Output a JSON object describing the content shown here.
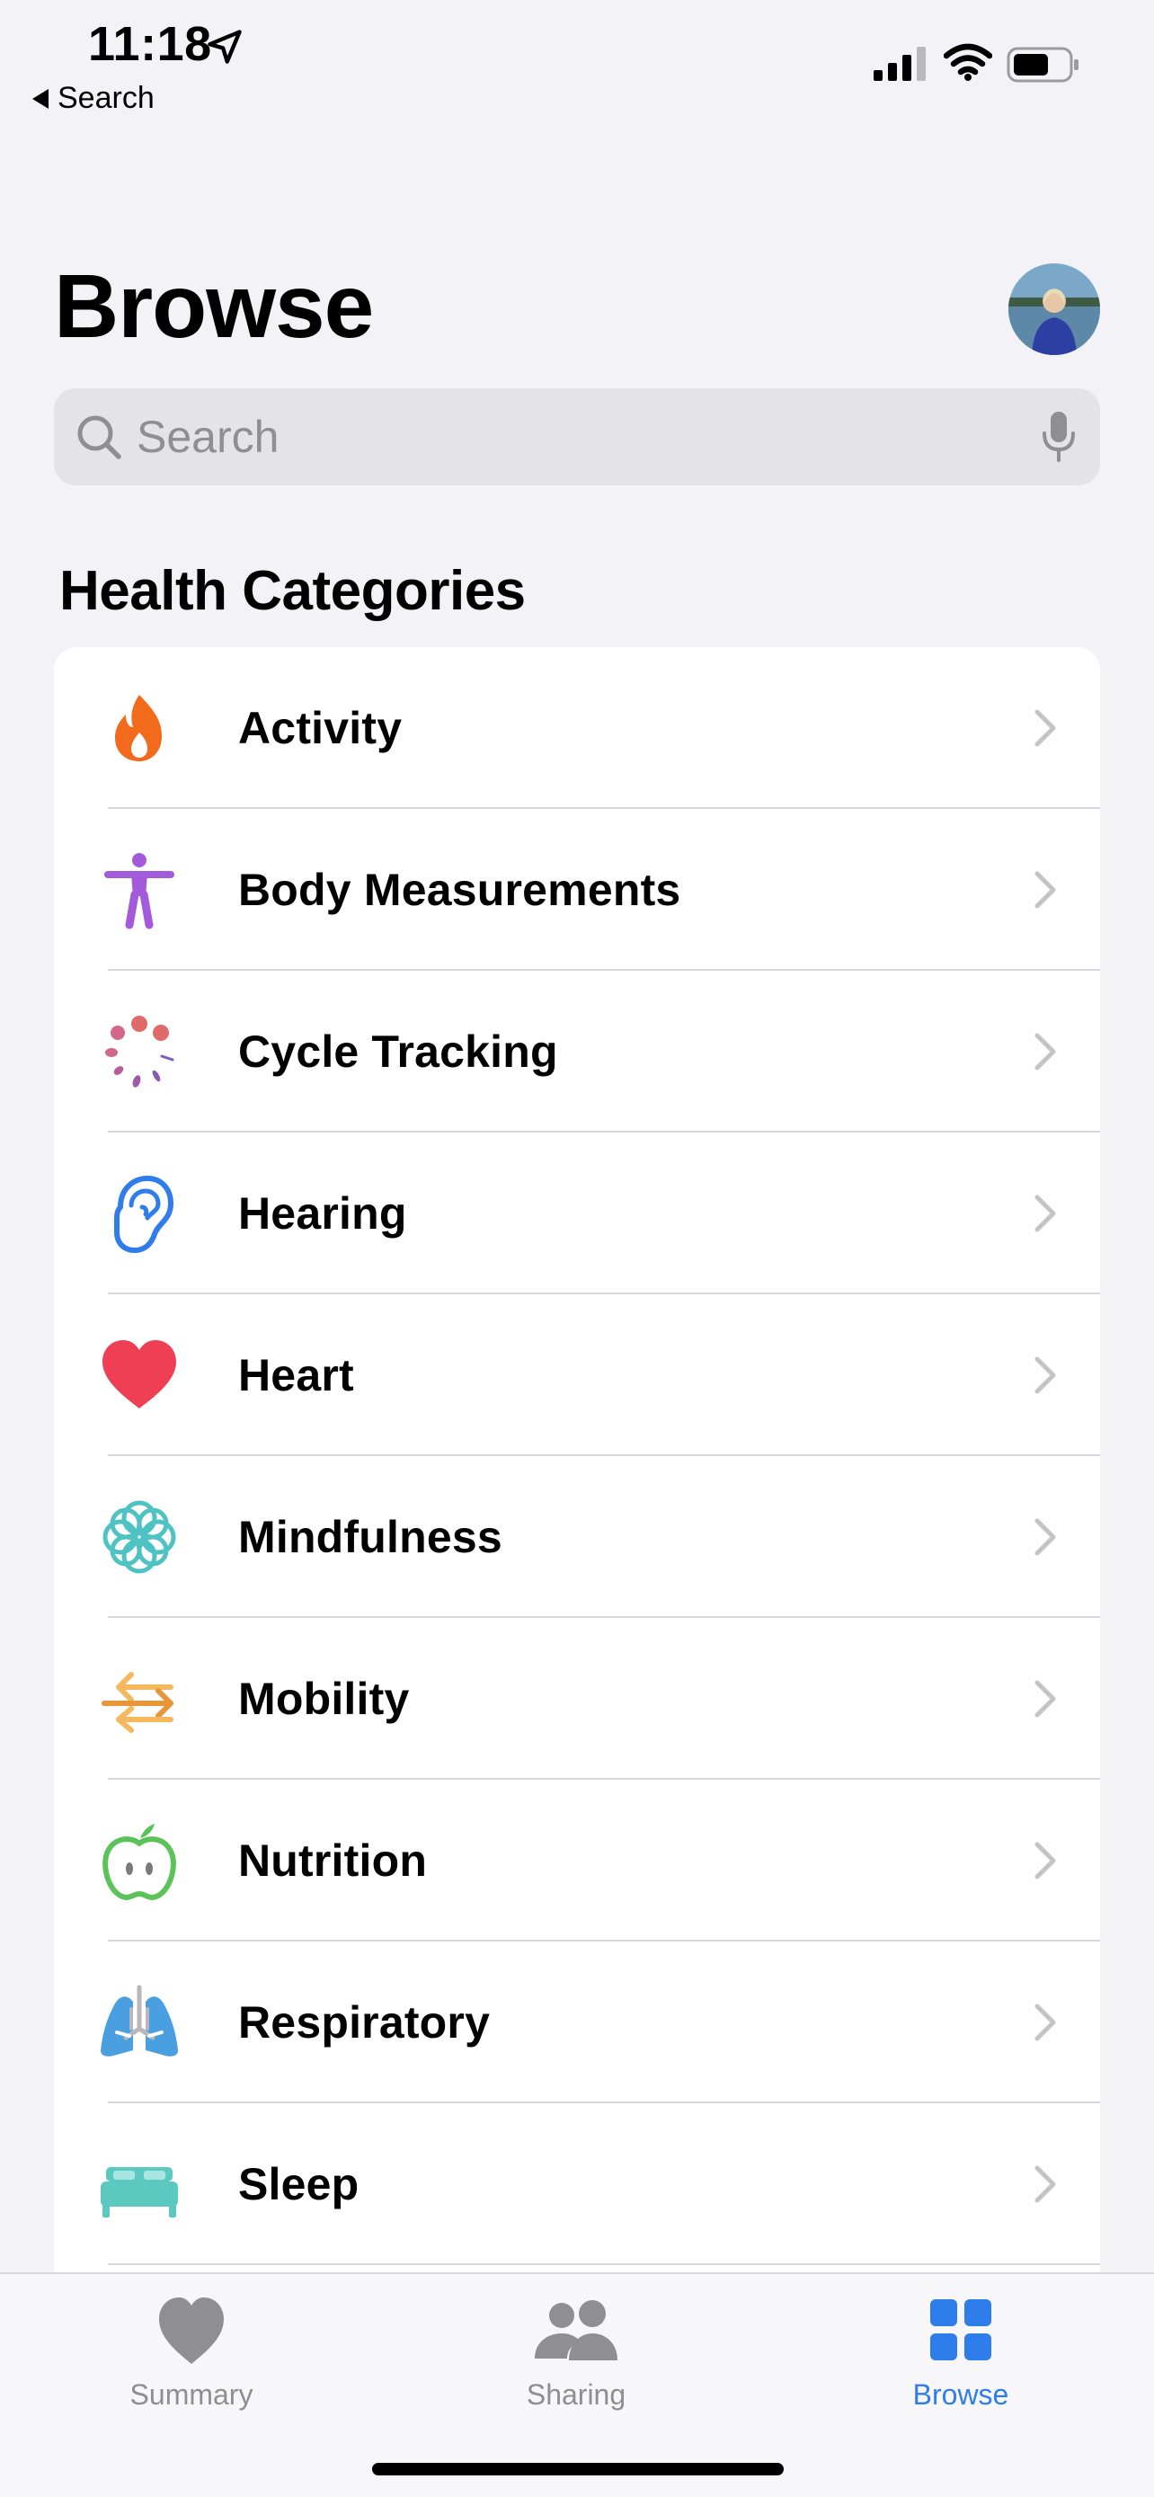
{
  "status": {
    "time": "11:18",
    "back_label": "Search"
  },
  "header": {
    "title": "Browse"
  },
  "search": {
    "placeholder": "Search"
  },
  "section": {
    "title": "Health Categories"
  },
  "categories": [
    {
      "label": "Activity",
      "icon": "flame-icon",
      "color": "#F26B1D"
    },
    {
      "label": "Body Measurements",
      "icon": "figure-icon",
      "color": "#A35BDB"
    },
    {
      "label": "Cycle Tracking",
      "icon": "cycle-dots-icon",
      "color": "#E06A6A"
    },
    {
      "label": "Hearing",
      "icon": "ear-icon",
      "color": "#2F7CEB"
    },
    {
      "label": "Heart",
      "icon": "heart-icon",
      "color": "#EF3F55"
    },
    {
      "label": "Mindfulness",
      "icon": "flower-icon",
      "color": "#4FC2C4"
    },
    {
      "label": "Mobility",
      "icon": "arrows-icon",
      "color": "#F2A33A"
    },
    {
      "label": "Nutrition",
      "icon": "apple-icon",
      "color": "#5CC35A"
    },
    {
      "label": "Respiratory",
      "icon": "lungs-icon",
      "color": "#4A9FE0"
    },
    {
      "label": "Sleep",
      "icon": "bed-icon",
      "color": "#5CC9C1"
    }
  ],
  "tabbar": {
    "tabs": [
      {
        "label": "Summary",
        "icon": "heart-icon",
        "active": false
      },
      {
        "label": "Sharing",
        "icon": "people-icon",
        "active": false
      },
      {
        "label": "Browse",
        "icon": "grid-icon",
        "active": true
      }
    ]
  },
  "colors": {
    "background": "#F2F2F7",
    "accent": "#2F7CEB",
    "inactive": "#8E8E93"
  }
}
